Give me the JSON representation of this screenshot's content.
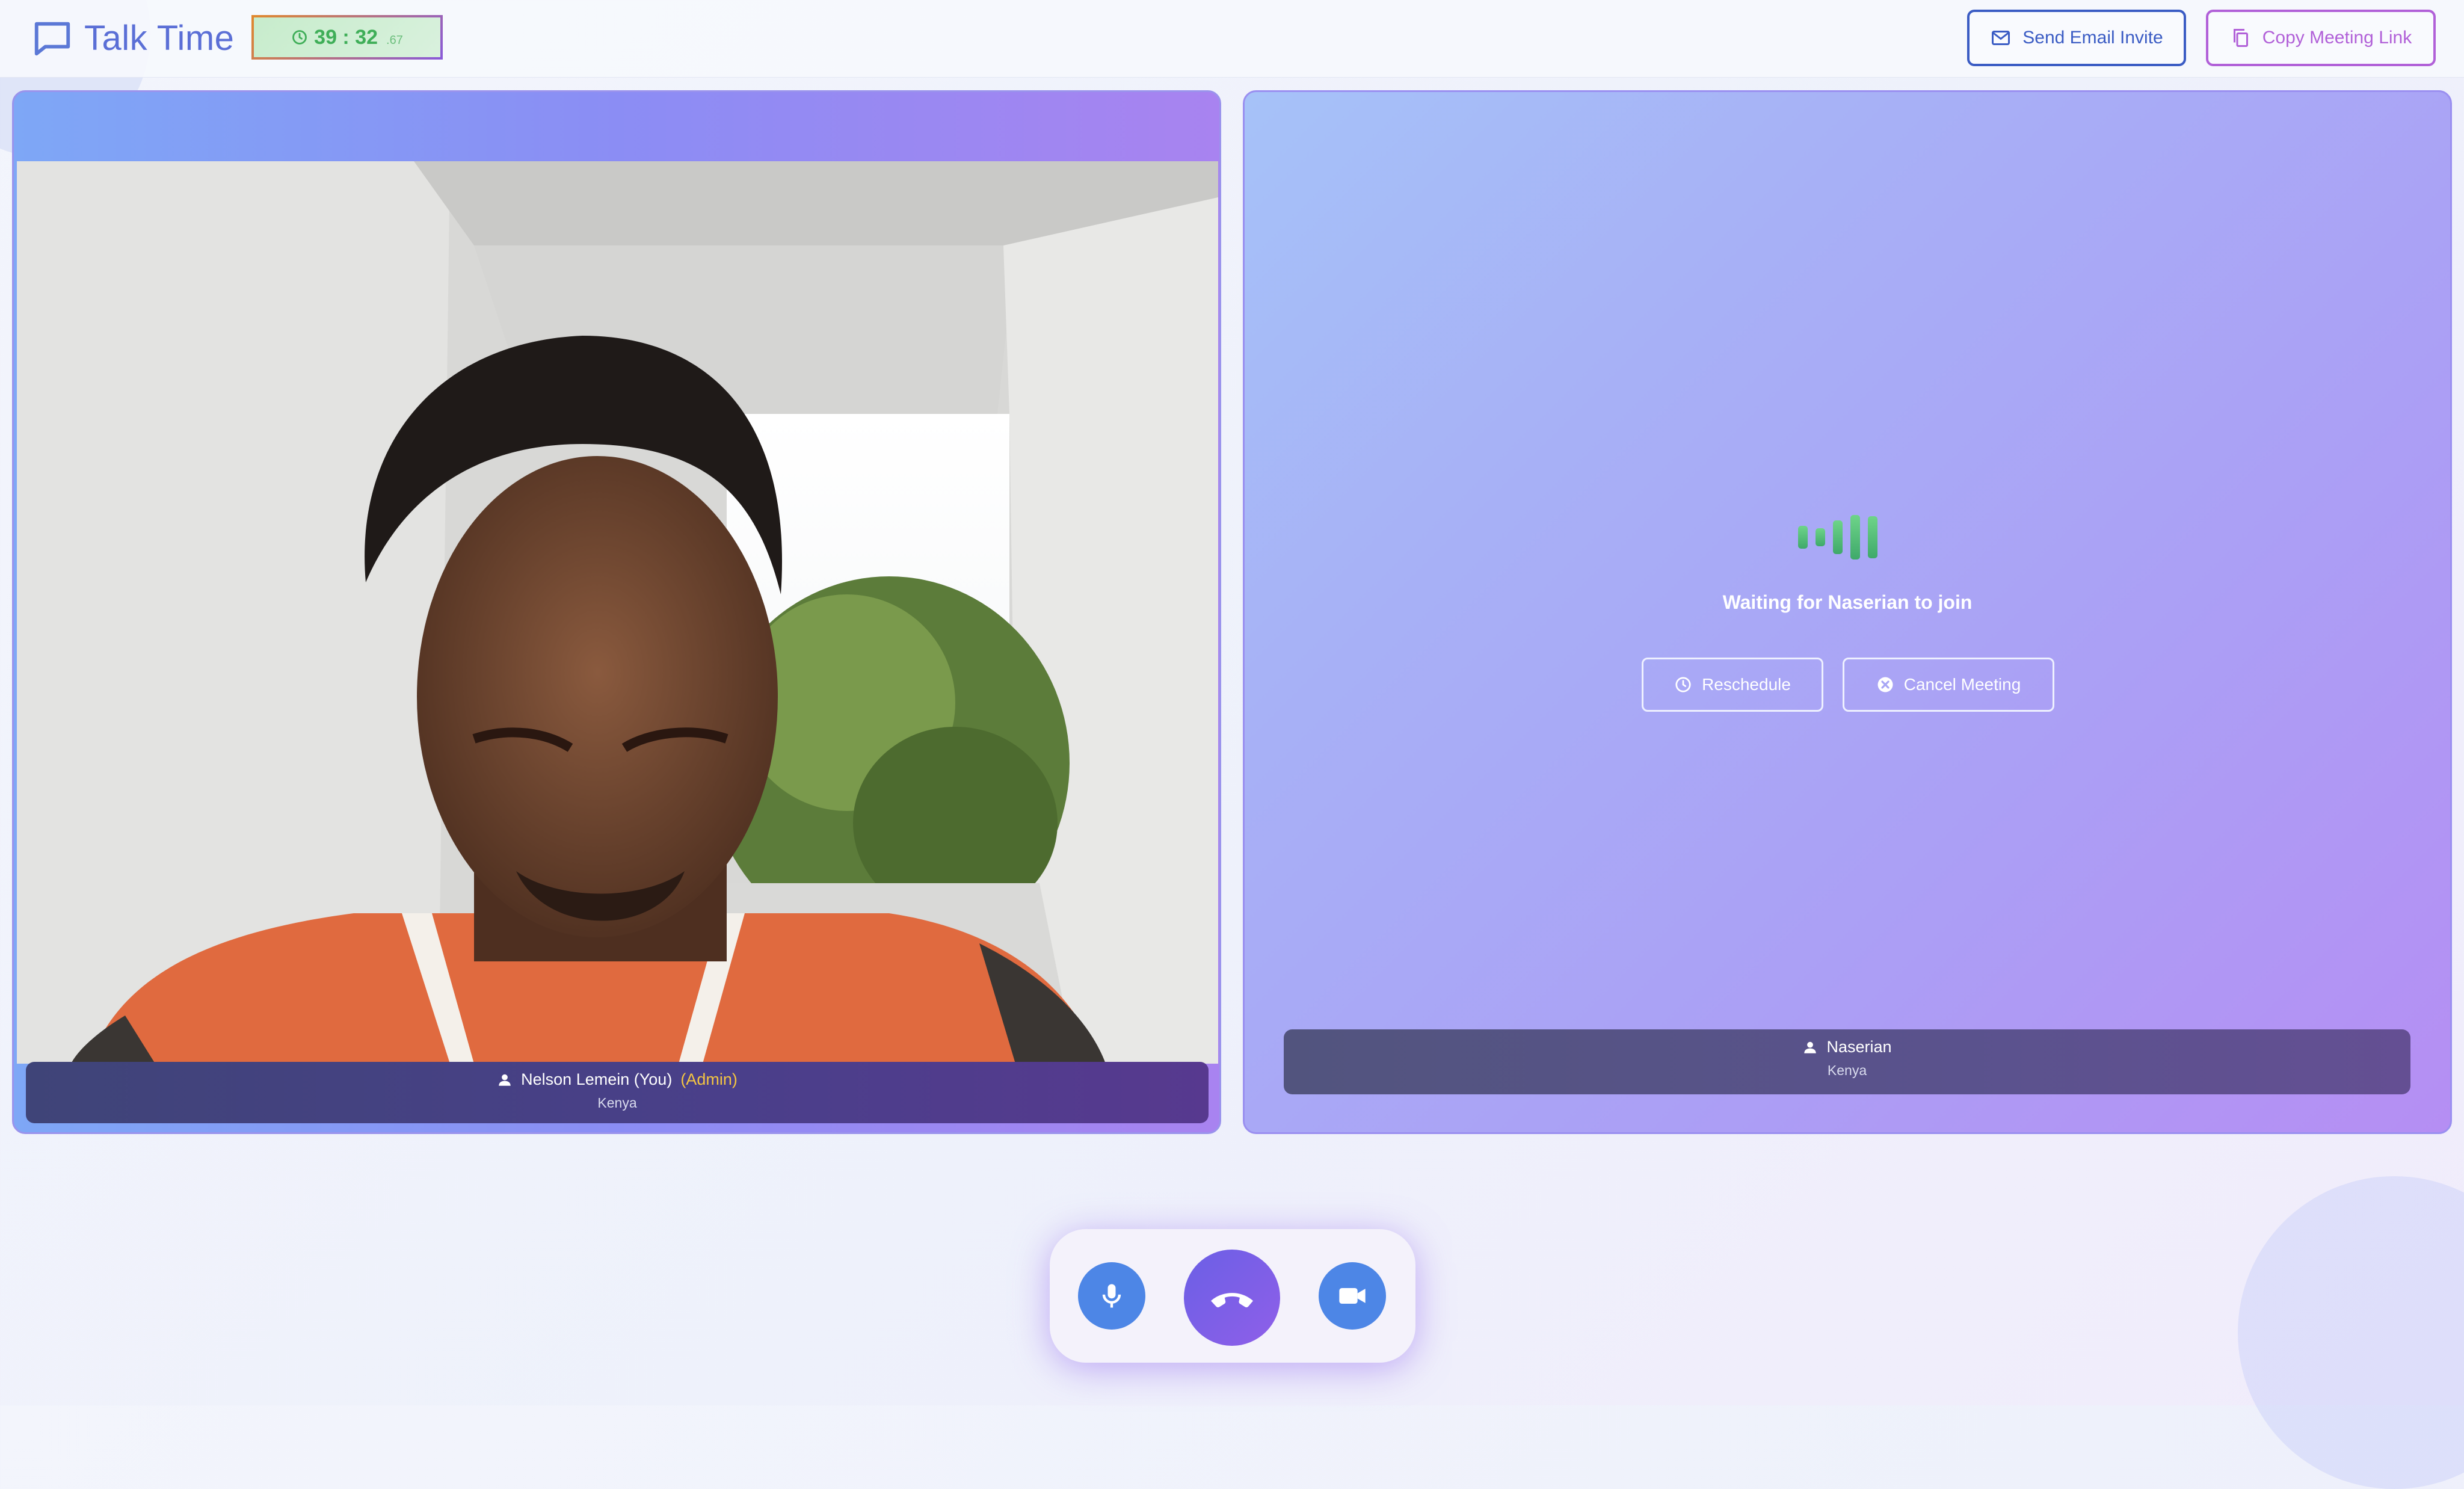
{
  "app": {
    "title": "Talk Time",
    "timer": {
      "main": "39 : 32",
      "fraction": ".67"
    }
  },
  "header": {
    "send_email_label": "Send Email Invite",
    "copy_link_label": "Copy Meeting Link"
  },
  "local_participant": {
    "name": "Nelson Lemein (You)",
    "role": "(Admin)",
    "country": "Kenya"
  },
  "remote_participant": {
    "waiting_text": "Waiting for Naserian to join",
    "name": "Naserian",
    "country": "Kenya",
    "reschedule_label": "Reschedule",
    "cancel_label": "Cancel Meeting"
  },
  "controls": [
    "mic-icon",
    "end-call-icon",
    "camera-icon"
  ],
  "colors": {
    "brand": "#5b6fd6",
    "timer_text": "#3fae58",
    "email_button": "#3b5cc4",
    "copy_button": "#b160d8",
    "admin_badge": "#f4c542",
    "control_blue": "#4d86e6",
    "end_call": "#7b5fe7"
  }
}
